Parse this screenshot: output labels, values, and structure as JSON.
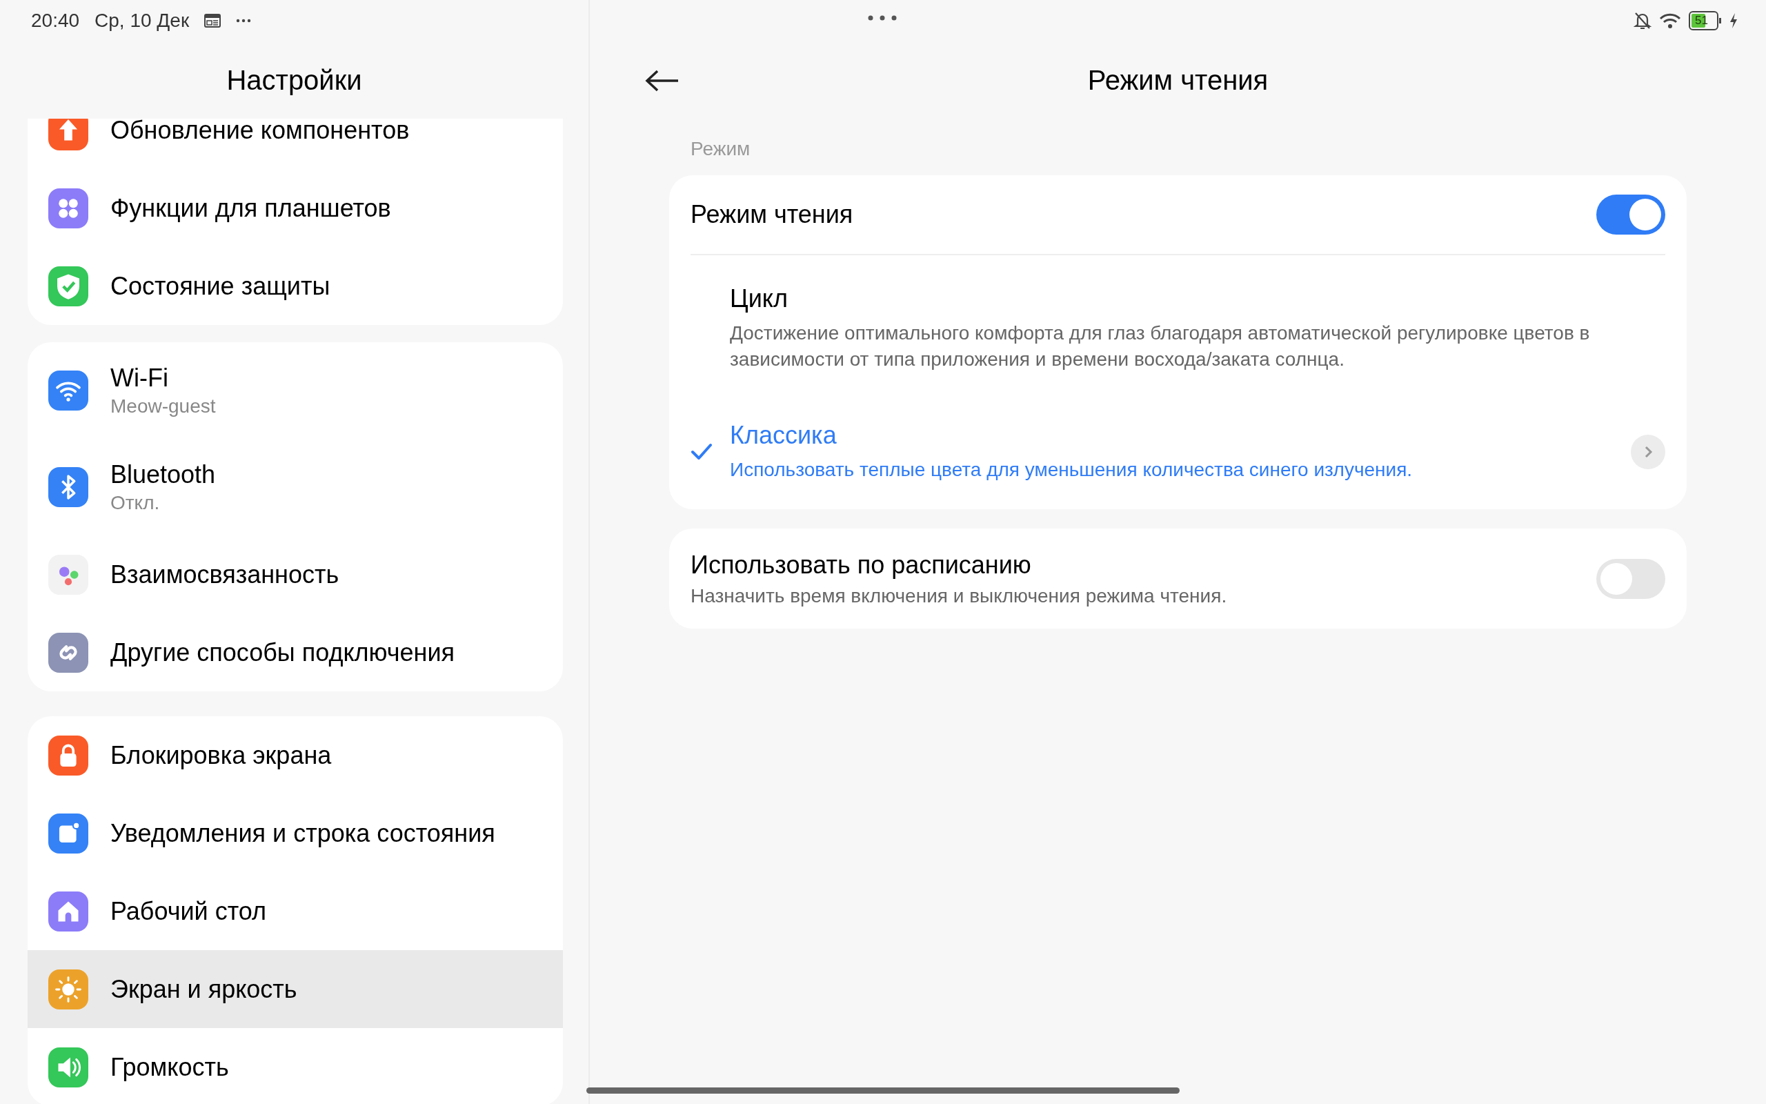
{
  "status_bar": {
    "time": "20:40",
    "date": "Ср, 10 Дек",
    "battery": "51"
  },
  "sidebar": {
    "title": "Настройки",
    "groups": [
      {
        "items": [
          {
            "label": "Обновление компонентов",
            "kind": "update",
            "selected": false
          },
          {
            "label": "Функции для планшетов",
            "kind": "tablet",
            "selected": false
          },
          {
            "label": "Состояние защиты",
            "kind": "shield",
            "selected": false
          }
        ]
      },
      {
        "items": [
          {
            "label": "Wi-Fi",
            "sublabel": "Meow-guest",
            "kind": "wifi",
            "selected": false
          },
          {
            "label": "Bluetooth",
            "sublabel": "Откл.",
            "kind": "bluetooth",
            "selected": false
          },
          {
            "label": "Взаимосвязанность",
            "kind": "connect",
            "selected": false
          },
          {
            "label": "Другие способы подключения",
            "kind": "link",
            "selected": false
          }
        ]
      },
      {
        "items": [
          {
            "label": "Блокировка экрана",
            "kind": "lock",
            "selected": false
          },
          {
            "label": "Уведомления и строка состояния",
            "kind": "notify",
            "selected": false
          },
          {
            "label": "Рабочий стол",
            "kind": "home",
            "selected": false
          },
          {
            "label": "Экран и яркость",
            "kind": "sun",
            "selected": true
          },
          {
            "label": "Громкость",
            "kind": "sound",
            "selected": false
          }
        ]
      }
    ]
  },
  "detail": {
    "title": "Режим чтения",
    "section_label": "Режим",
    "main_toggle": {
      "label": "Режим чтения",
      "on": true
    },
    "modes": [
      {
        "title": "Цикл",
        "description": "Достижение оптимального комфорта для глаз благодаря автоматической регулировке цветов в зависимости от типа приложения и времени восхода/заката солнца.",
        "selected": false,
        "has_settings": false
      },
      {
        "title": "Классика",
        "description": "Использовать теплые цвета для уменьшения количества синего излучения.",
        "selected": true,
        "has_settings": true
      }
    ],
    "schedule": {
      "label": "Использовать по расписанию",
      "description": "Назначить время включения и выключения режима чтения.",
      "on": false
    }
  }
}
